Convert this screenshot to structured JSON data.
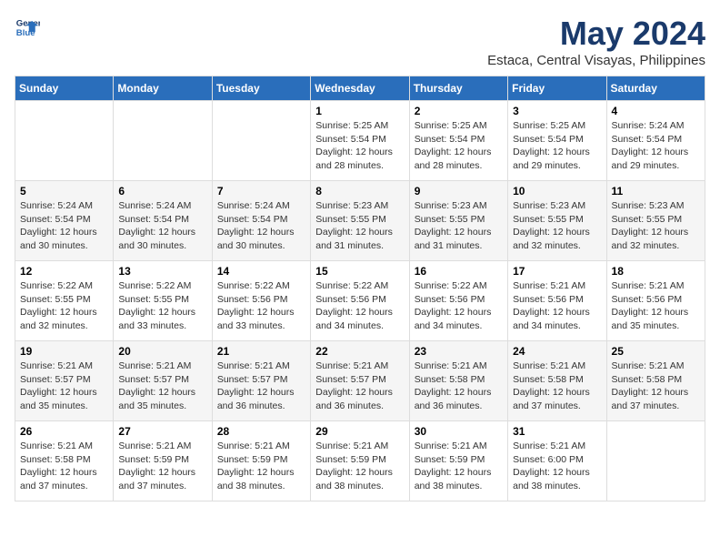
{
  "header": {
    "logo_line1": "General",
    "logo_line2": "Blue",
    "month_title": "May 2024",
    "location": "Estaca, Central Visayas, Philippines"
  },
  "weekdays": [
    "Sunday",
    "Monday",
    "Tuesday",
    "Wednesday",
    "Thursday",
    "Friday",
    "Saturday"
  ],
  "weeks": [
    [
      {
        "date": "",
        "info": ""
      },
      {
        "date": "",
        "info": ""
      },
      {
        "date": "",
        "info": ""
      },
      {
        "date": "1",
        "info": "Sunrise: 5:25 AM\nSunset: 5:54 PM\nDaylight: 12 hours\nand 28 minutes."
      },
      {
        "date": "2",
        "info": "Sunrise: 5:25 AM\nSunset: 5:54 PM\nDaylight: 12 hours\nand 28 minutes."
      },
      {
        "date": "3",
        "info": "Sunrise: 5:25 AM\nSunset: 5:54 PM\nDaylight: 12 hours\nand 29 minutes."
      },
      {
        "date": "4",
        "info": "Sunrise: 5:24 AM\nSunset: 5:54 PM\nDaylight: 12 hours\nand 29 minutes."
      }
    ],
    [
      {
        "date": "5",
        "info": "Sunrise: 5:24 AM\nSunset: 5:54 PM\nDaylight: 12 hours\nand 30 minutes."
      },
      {
        "date": "6",
        "info": "Sunrise: 5:24 AM\nSunset: 5:54 PM\nDaylight: 12 hours\nand 30 minutes."
      },
      {
        "date": "7",
        "info": "Sunrise: 5:24 AM\nSunset: 5:54 PM\nDaylight: 12 hours\nand 30 minutes."
      },
      {
        "date": "8",
        "info": "Sunrise: 5:23 AM\nSunset: 5:55 PM\nDaylight: 12 hours\nand 31 minutes."
      },
      {
        "date": "9",
        "info": "Sunrise: 5:23 AM\nSunset: 5:55 PM\nDaylight: 12 hours\nand 31 minutes."
      },
      {
        "date": "10",
        "info": "Sunrise: 5:23 AM\nSunset: 5:55 PM\nDaylight: 12 hours\nand 32 minutes."
      },
      {
        "date": "11",
        "info": "Sunrise: 5:23 AM\nSunset: 5:55 PM\nDaylight: 12 hours\nand 32 minutes."
      }
    ],
    [
      {
        "date": "12",
        "info": "Sunrise: 5:22 AM\nSunset: 5:55 PM\nDaylight: 12 hours\nand 32 minutes."
      },
      {
        "date": "13",
        "info": "Sunrise: 5:22 AM\nSunset: 5:55 PM\nDaylight: 12 hours\nand 33 minutes."
      },
      {
        "date": "14",
        "info": "Sunrise: 5:22 AM\nSunset: 5:56 PM\nDaylight: 12 hours\nand 33 minutes."
      },
      {
        "date": "15",
        "info": "Sunrise: 5:22 AM\nSunset: 5:56 PM\nDaylight: 12 hours\nand 34 minutes."
      },
      {
        "date": "16",
        "info": "Sunrise: 5:22 AM\nSunset: 5:56 PM\nDaylight: 12 hours\nand 34 minutes."
      },
      {
        "date": "17",
        "info": "Sunrise: 5:21 AM\nSunset: 5:56 PM\nDaylight: 12 hours\nand 34 minutes."
      },
      {
        "date": "18",
        "info": "Sunrise: 5:21 AM\nSunset: 5:56 PM\nDaylight: 12 hours\nand 35 minutes."
      }
    ],
    [
      {
        "date": "19",
        "info": "Sunrise: 5:21 AM\nSunset: 5:57 PM\nDaylight: 12 hours\nand 35 minutes."
      },
      {
        "date": "20",
        "info": "Sunrise: 5:21 AM\nSunset: 5:57 PM\nDaylight: 12 hours\nand 35 minutes."
      },
      {
        "date": "21",
        "info": "Sunrise: 5:21 AM\nSunset: 5:57 PM\nDaylight: 12 hours\nand 36 minutes."
      },
      {
        "date": "22",
        "info": "Sunrise: 5:21 AM\nSunset: 5:57 PM\nDaylight: 12 hours\nand 36 minutes."
      },
      {
        "date": "23",
        "info": "Sunrise: 5:21 AM\nSunset: 5:58 PM\nDaylight: 12 hours\nand 36 minutes."
      },
      {
        "date": "24",
        "info": "Sunrise: 5:21 AM\nSunset: 5:58 PM\nDaylight: 12 hours\nand 37 minutes."
      },
      {
        "date": "25",
        "info": "Sunrise: 5:21 AM\nSunset: 5:58 PM\nDaylight: 12 hours\nand 37 minutes."
      }
    ],
    [
      {
        "date": "26",
        "info": "Sunrise: 5:21 AM\nSunset: 5:58 PM\nDaylight: 12 hours\nand 37 minutes."
      },
      {
        "date": "27",
        "info": "Sunrise: 5:21 AM\nSunset: 5:59 PM\nDaylight: 12 hours\nand 37 minutes."
      },
      {
        "date": "28",
        "info": "Sunrise: 5:21 AM\nSunset: 5:59 PM\nDaylight: 12 hours\nand 38 minutes."
      },
      {
        "date": "29",
        "info": "Sunrise: 5:21 AM\nSunset: 5:59 PM\nDaylight: 12 hours\nand 38 minutes."
      },
      {
        "date": "30",
        "info": "Sunrise: 5:21 AM\nSunset: 5:59 PM\nDaylight: 12 hours\nand 38 minutes."
      },
      {
        "date": "31",
        "info": "Sunrise: 5:21 AM\nSunset: 6:00 PM\nDaylight: 12 hours\nand 38 minutes."
      },
      {
        "date": "",
        "info": ""
      }
    ]
  ]
}
